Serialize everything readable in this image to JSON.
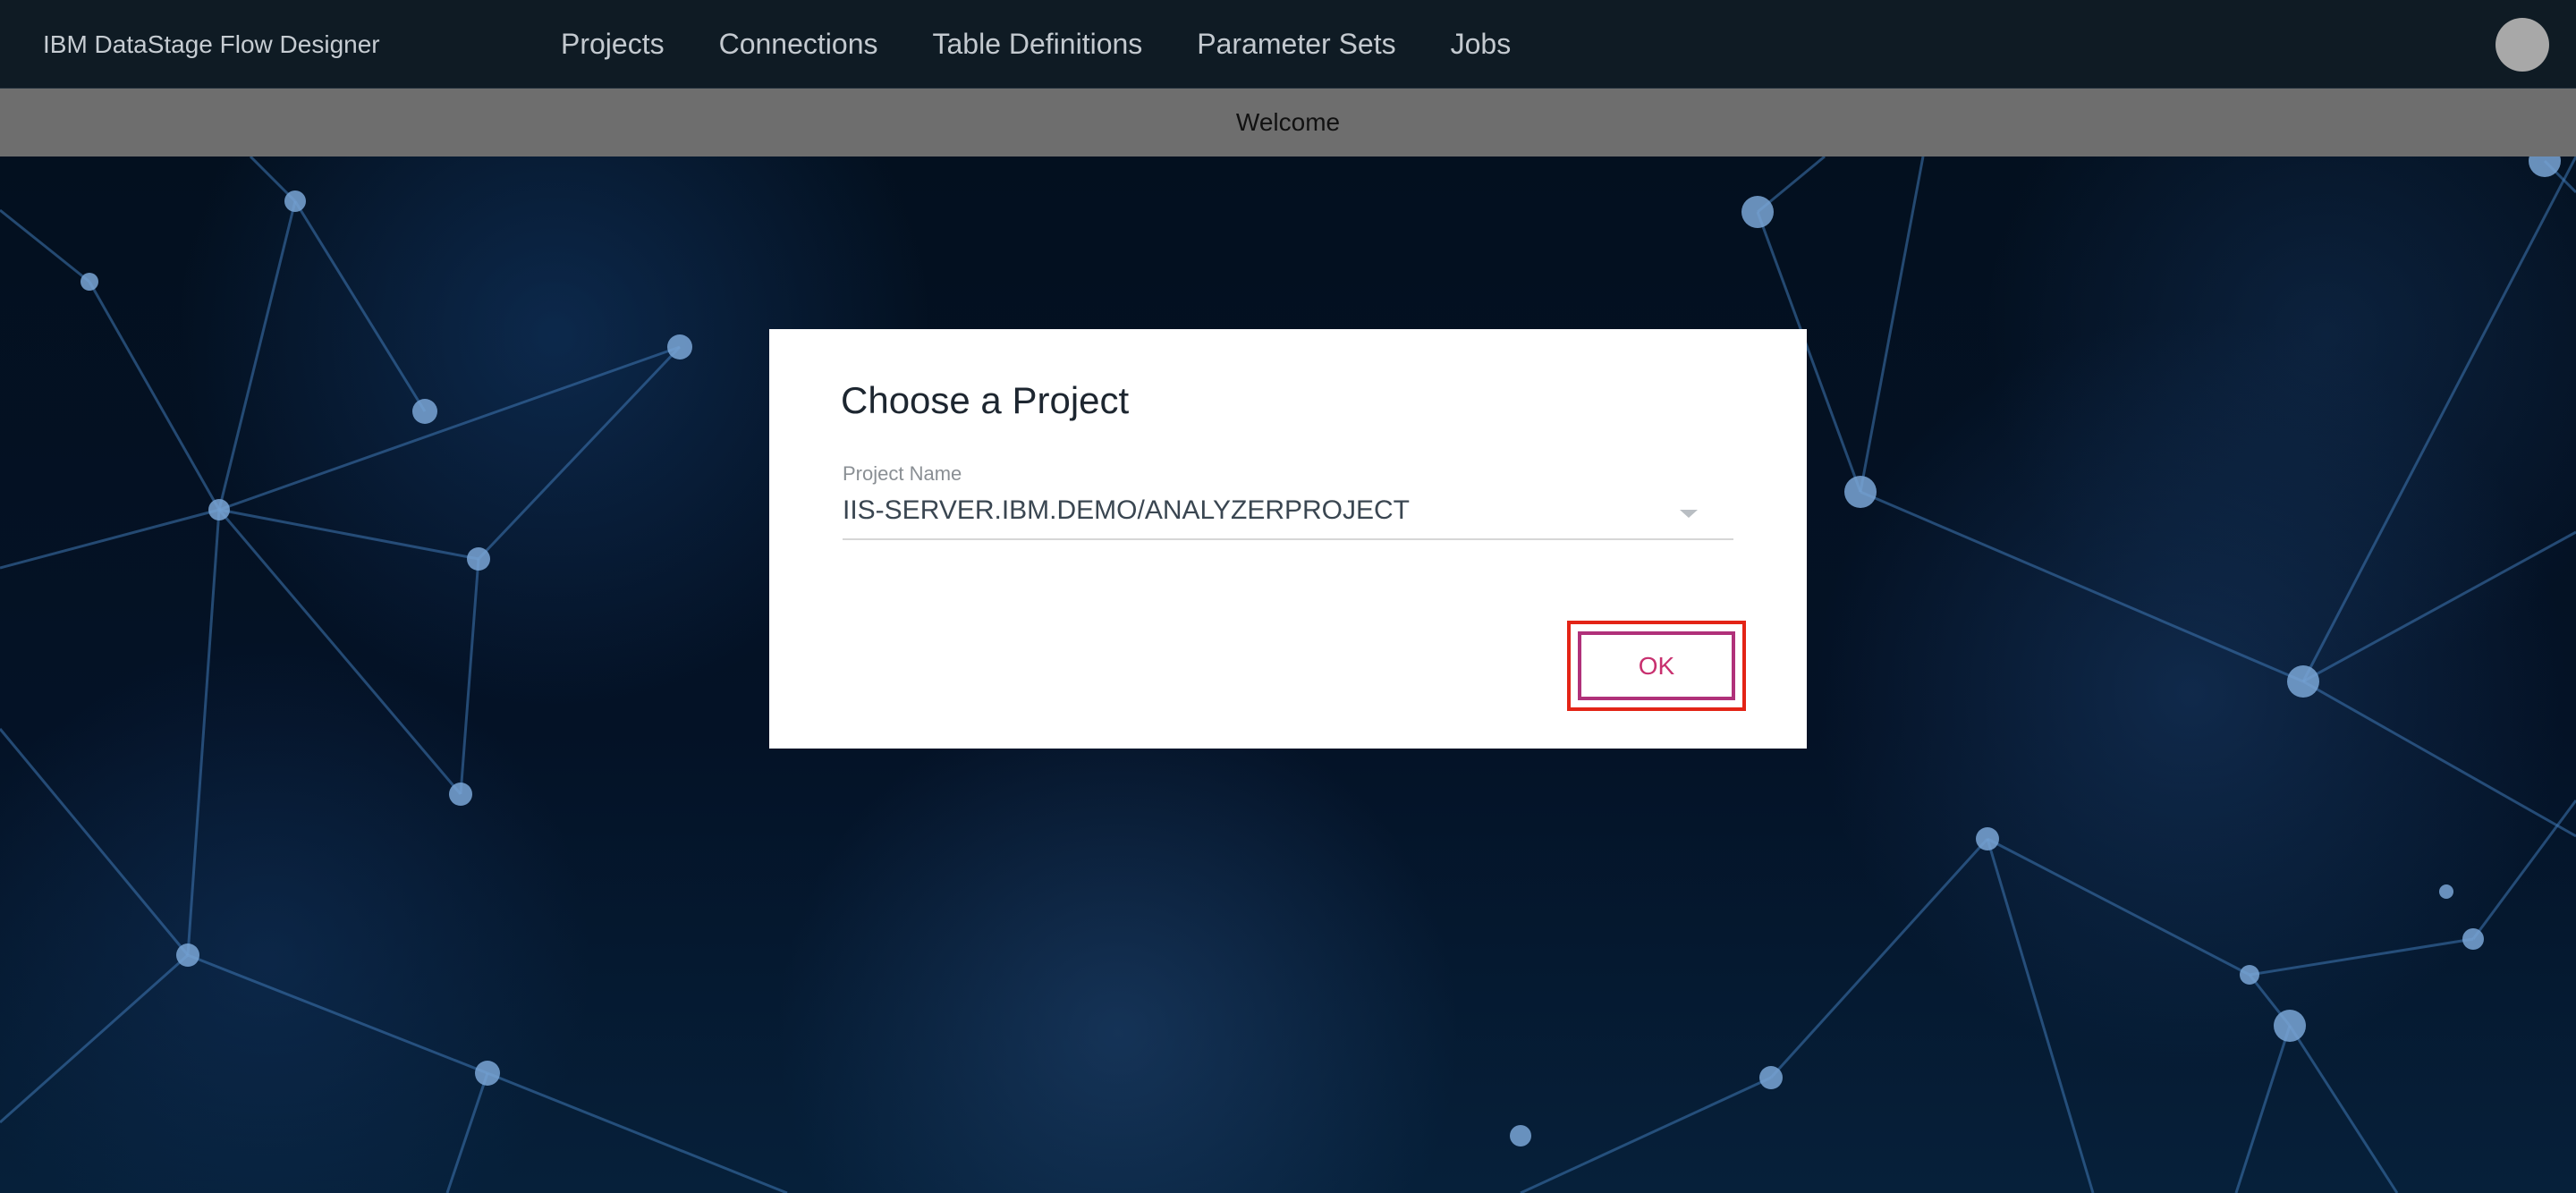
{
  "app": {
    "brand": "IBM DataStage Flow Designer"
  },
  "nav": {
    "items": [
      {
        "label": "Projects"
      },
      {
        "label": "Connections"
      },
      {
        "label": "Table Definitions"
      },
      {
        "label": "Parameter Sets"
      },
      {
        "label": "Jobs"
      }
    ]
  },
  "welcome": {
    "label": "Welcome"
  },
  "dialog": {
    "title": "Choose a Project",
    "field_label": "Project Name",
    "selected_project": "IIS-SERVER.IBM.DEMO/ANALYZERPROJECT",
    "ok_label": "OK"
  },
  "icons": {
    "avatar": "user-avatar-icon",
    "dropdown": "chevron-down-icon"
  },
  "colors": {
    "topbar_bg": "#0f1b24",
    "welcome_bg": "#6e6e6e",
    "ok_text": "#c8306f",
    "ok_border": "#b0317a",
    "highlight": "#e32416"
  }
}
